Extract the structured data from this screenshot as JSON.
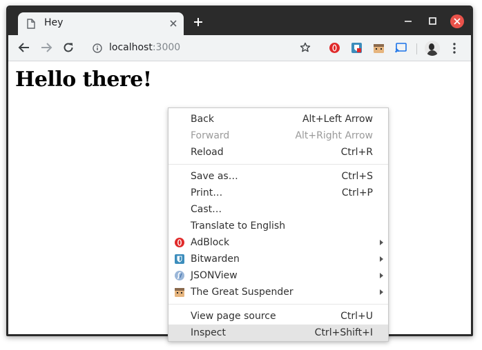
{
  "browser": {
    "tab_title": "Hey",
    "url_host": "localhost",
    "url_port": ":3000",
    "accent": "#e9524a"
  },
  "icons": {
    "back": "arrow-left-icon",
    "forward": "arrow-right-icon",
    "reload": "reload-icon",
    "info": "info-icon",
    "star": "star-icon",
    "menu": "more-vert-icon"
  },
  "page": {
    "heading": "Hello there!"
  },
  "context_menu": {
    "group1": [
      {
        "label": "Back",
        "shortcut": "Alt+Left Arrow",
        "disabled": false
      },
      {
        "label": "Forward",
        "shortcut": "Alt+Right Arrow",
        "disabled": true
      },
      {
        "label": "Reload",
        "shortcut": "Ctrl+R",
        "disabled": false
      }
    ],
    "group2": [
      {
        "label": "Save as…",
        "shortcut": "Ctrl+S"
      },
      {
        "label": "Print…",
        "shortcut": "Ctrl+P"
      },
      {
        "label": "Cast…",
        "shortcut": ""
      },
      {
        "label": "Translate to English",
        "shortcut": ""
      },
      {
        "label": "AdBlock",
        "icon": "adblock-icon",
        "submenu": true
      },
      {
        "label": "Bitwarden",
        "icon": "bitwarden-icon",
        "submenu": true
      },
      {
        "label": "JSONView",
        "icon": "jsonview-icon",
        "submenu": true
      },
      {
        "label": "The Great Suspender",
        "icon": "great-suspender-icon",
        "submenu": true
      }
    ],
    "group3": [
      {
        "label": "View page source",
        "shortcut": "Ctrl+U"
      },
      {
        "label": "Inspect",
        "shortcut": "Ctrl+Shift+I",
        "highlighted": true
      }
    ]
  }
}
